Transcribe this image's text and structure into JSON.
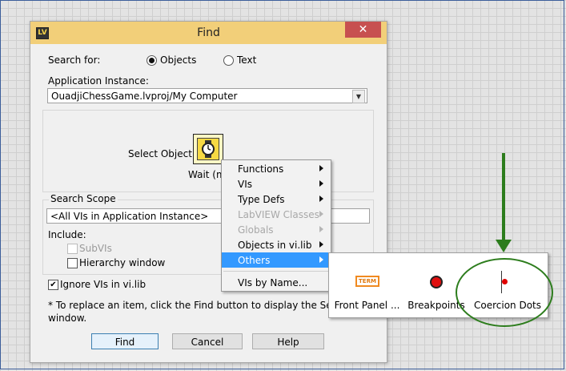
{
  "dialog": {
    "title": "Find",
    "app_icon": "LV",
    "close_icon": "✕",
    "search_for_label": "Search for:",
    "radio_objects": "Objects",
    "radio_text": "Text",
    "search_for_selected": "Objects",
    "app_instance_label": "Application Instance:",
    "app_instance_value": "OuadjiChessGame.lvproj/My Computer",
    "select_object_label": "Select Object:",
    "selected_object_caption": "Wait (m",
    "search_scope_label": "Search Scope",
    "search_scope_value": "<All VIs in Application Instance>",
    "include_label": "Include:",
    "subvis_label": "SubVIs",
    "subvis_enabled": false,
    "hierarchy_label": "Hierarchy window",
    "hierarchy_checked": false,
    "ignore_vilib_label": "Ignore VIs in vi.lib",
    "ignore_vilib_checked": true,
    "footnote_line1": "* To replace an item, click the Find button to display the Search Res",
    "footnote_line2": "window.",
    "find_button": "Find",
    "cancel_button": "Cancel",
    "help_button": "Help",
    "check_mark": "✔"
  },
  "context_menu": {
    "items": [
      {
        "label": "Functions",
        "submenu": true,
        "enabled": true
      },
      {
        "label": "VIs",
        "submenu": true,
        "enabled": true
      },
      {
        "label": "Type Defs",
        "submenu": true,
        "enabled": true
      },
      {
        "label": "LabVIEW Classes",
        "submenu": true,
        "enabled": false
      },
      {
        "label": "Globals",
        "submenu": true,
        "enabled": false
      },
      {
        "label": "Objects in vi.lib",
        "submenu": true,
        "enabled": true
      },
      {
        "label": "Others",
        "submenu": true,
        "enabled": true,
        "highlighted": true
      },
      {
        "label": "VIs by Name...",
        "submenu": false,
        "enabled": true
      }
    ]
  },
  "others_palette": {
    "items": [
      {
        "label": "Front Panel ...",
        "icon": "front-panel-terminal-icon",
        "icon_text": "TERM"
      },
      {
        "label": "Breakpoints",
        "icon": "breakpoint-icon"
      },
      {
        "label": "Coercion Dots",
        "icon": "coercion-dot-icon"
      }
    ]
  },
  "annotation": {
    "color": "#2d7d1d",
    "arrow_icon": "down-arrow-icon",
    "highlight": "Coercion Dots"
  },
  "colors": {
    "titlebar": "#f2cf79",
    "close_button": "#c75050",
    "menu_highlight": "#3399ff"
  }
}
